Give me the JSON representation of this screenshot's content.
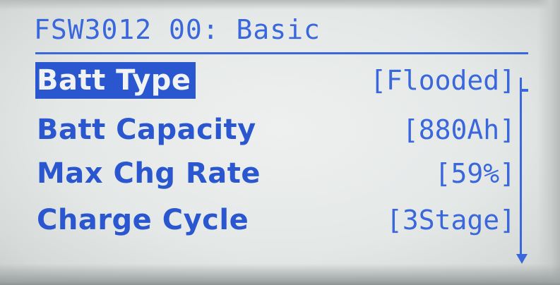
{
  "header": {
    "title": "FSW3012 00: Basic"
  },
  "menu": {
    "items": [
      {
        "label": "Batt Type",
        "value": "[Flooded]",
        "selected": true
      },
      {
        "label": "Batt Capacity",
        "value": "[880Ah]",
        "selected": false
      },
      {
        "label": "Max Chg Rate",
        "value": "[59%]",
        "selected": false
      },
      {
        "label": "Charge Cycle",
        "value": "[3Stage]",
        "selected": false
      }
    ]
  },
  "colors": {
    "lcd_background": "#e4e8e7",
    "lcd_foreground": "#2a57cf"
  },
  "icons": {
    "scroll_down": "scroll-down-arrow-icon"
  }
}
